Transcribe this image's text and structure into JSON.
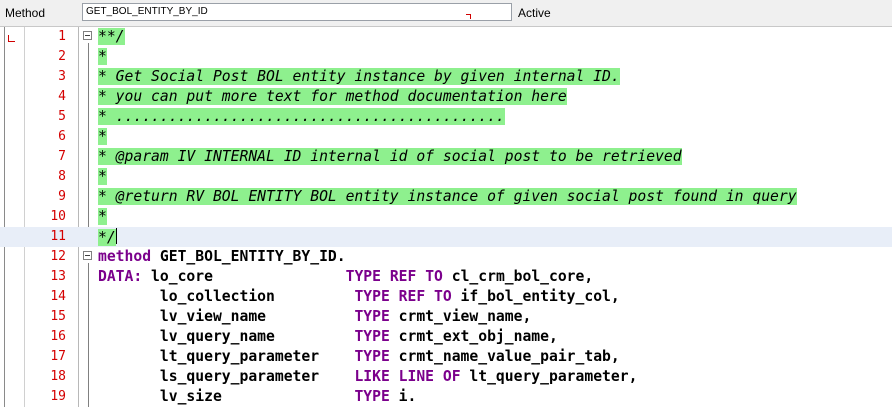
{
  "header": {
    "label": "Method",
    "method_name": "GET_BOL_ENTITY_BY_ID",
    "status": "Active"
  },
  "editor": {
    "lines": [
      {
        "num": "1",
        "text": "**/"
      },
      {
        "num": "2",
        "text": "*"
      },
      {
        "num": "3",
        "text": "* Get Social Post BOL entity instance by given internal ID."
      },
      {
        "num": "4",
        "text": "* you can put more text for method documentation here"
      },
      {
        "num": "5",
        "text": "* ............................................"
      },
      {
        "num": "6",
        "text": "*"
      },
      {
        "num": "7",
        "text": "* @param IV INTERNAL ID internal id of social post to be retrieved"
      },
      {
        "num": "8",
        "text": "*"
      },
      {
        "num": "9",
        "text": "* @return RV BOL ENTITY BOL entity instance of given social post found in query"
      },
      {
        "num": "10",
        "text": "*"
      },
      {
        "num": "11",
        "text": "*/"
      },
      {
        "num": "12",
        "kw1": "method",
        "rest": " GET_BOL_ENTITY_BY_ID."
      },
      {
        "num": "13",
        "kw1": "DATA:",
        "name": " lo_core               ",
        "kw2": "TYPE REF TO",
        "type": " cl_crm_bol_core,"
      },
      {
        "num": "14",
        "name": "       lo_collection         ",
        "kw2": "TYPE REF TO",
        "type": " if_bol_entity_col,"
      },
      {
        "num": "15",
        "name": "       lv_view_name          ",
        "kw2": "TYPE",
        "type": " crmt_view_name,"
      },
      {
        "num": "16",
        "name": "       lv_query_name         ",
        "kw2": "TYPE",
        "type": " crmt_ext_obj_name,"
      },
      {
        "num": "17",
        "name": "       lt_query_parameter    ",
        "kw2": "TYPE",
        "type": " crmt_name_value_pair_tab,"
      },
      {
        "num": "18",
        "name": "       ls_query_parameter    ",
        "kw2": "LIKE LINE OF",
        "type": " lt_query_parameter,"
      },
      {
        "num": "19",
        "name": "       lv_size               ",
        "kw2": "TYPE",
        "type": " i."
      }
    ]
  }
}
